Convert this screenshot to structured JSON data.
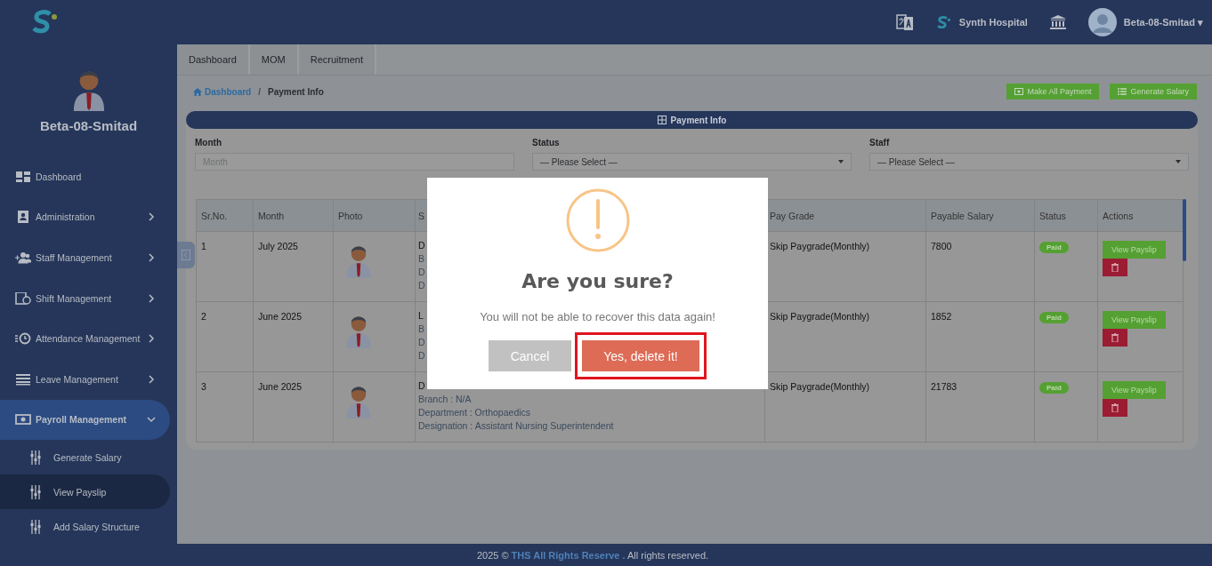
{
  "header": {
    "hospital": "Synth Hospital",
    "user": "Beta-08-Smitad",
    "caret": "▾"
  },
  "sidebar": {
    "user_name": "Beta-08-Smitad",
    "items": [
      {
        "label": "Dashboard",
        "selected": false
      },
      {
        "label": "Administration",
        "selected": false,
        "expanded": false
      },
      {
        "label": "Staff Management",
        "selected": false,
        "expanded": false
      },
      {
        "label": "Shift Management",
        "selected": false,
        "expanded": false
      },
      {
        "label": "Attendance Management",
        "selected": false,
        "expanded": false
      },
      {
        "label": "Leave Management",
        "selected": false,
        "expanded": false
      },
      {
        "label": "Payroll Management",
        "selected": true,
        "expanded": true,
        "children": [
          {
            "label": "Generate Salary",
            "selected": false
          },
          {
            "label": "View Payslip",
            "selected": true
          },
          {
            "label": "Add Salary Structure",
            "selected": false
          }
        ]
      }
    ]
  },
  "tabs": [
    {
      "label": "Dashboard",
      "selected": false
    },
    {
      "label": "MOM",
      "selected": false
    },
    {
      "label": "Recruitment",
      "selected": false
    }
  ],
  "breadcrumb": {
    "home": "Dashboard",
    "separator": "/",
    "current": "Payment Info"
  },
  "actions": [
    {
      "label": "Make All Payment",
      "kind": "money"
    },
    {
      "label": "Generate Salary",
      "kind": "list"
    }
  ],
  "card": {
    "title": "Payment Info",
    "filters": [
      {
        "label": "Month",
        "kind": "input",
        "placeholder": "Month"
      },
      {
        "label": "Status",
        "kind": "select",
        "value": "— Please Select —"
      },
      {
        "label": "Staff",
        "kind": "select",
        "value": "— Please Select —"
      }
    ],
    "table": {
      "columns": [
        "Sr.No.",
        "Month",
        "Photo",
        "S",
        "Pay Grade",
        "Payable Salary",
        "Status",
        "Actions"
      ],
      "rows": [
        {
          "sr": "1",
          "month": "July 2025",
          "staff_lines": [
            "D",
            "B",
            "D",
            "D"
          ],
          "pay_grade": "Skip Paygrade(Monthly)",
          "salary": "7800",
          "status": "Paid",
          "action": "View Payslip"
        },
        {
          "sr": "2",
          "month": "June 2025",
          "staff_lines": [
            "L",
            "B",
            "D",
            "D"
          ],
          "pay_grade": "Skip Paygrade(Monthly)",
          "salary": "1852",
          "status": "Paid",
          "action": "View Payslip"
        },
        {
          "sr": "3",
          "month": "June 2025",
          "staff_lines": [
            "D",
            "Branch : N/A",
            "Department : Orthopaedics",
            "Designation : Assistant Nursing Superintendent"
          ],
          "pay_grade": "Skip Paygrade(Monthly)",
          "salary": "21783",
          "status": "Paid",
          "action": "View Payslip"
        }
      ]
    }
  },
  "modal": {
    "title": "Are you sure?",
    "text": "You will not be able to recover this data again!",
    "buttons": [
      {
        "label": "Cancel",
        "kind": "cancel",
        "highlighted": false
      },
      {
        "label": "Yes, delete it!",
        "kind": "confirm",
        "highlighted": true
      }
    ]
  },
  "footer": {
    "year": "2025 ©",
    "link": "THS All Rights Reserve .",
    "rest": "All rights reserved."
  }
}
